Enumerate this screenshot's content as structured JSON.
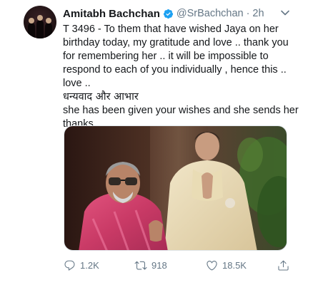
{
  "tweet": {
    "display_name": "Amitabh Bachchan",
    "handle": "@SrBachchan",
    "separator": "·",
    "time": "2h",
    "text_lines": [
      "T 3496 - To them that have wished Jaya on her",
      "birthday today, my gratitude and love .. thank you",
      "for remembering her .. it will be impossible to",
      "respond to each of you individually , hence this ..",
      "love ..",
      "धन्यवाद और आभार",
      "she has been given your wishes and she sends her",
      "thanks"
    ],
    "actions": {
      "reply_count": "1.2K",
      "retweet_count": "918",
      "like_count": "18.5K"
    },
    "icons": {
      "verified": "verified-badge-icon",
      "caret": "chevron-down-icon",
      "reply": "reply-icon",
      "retweet": "retweet-icon",
      "like": "heart-icon",
      "share": "share-icon"
    },
    "colors": {
      "verified_blue": "#1da1f2",
      "secondary_text": "#657786",
      "primary_text": "#14171a"
    }
  }
}
